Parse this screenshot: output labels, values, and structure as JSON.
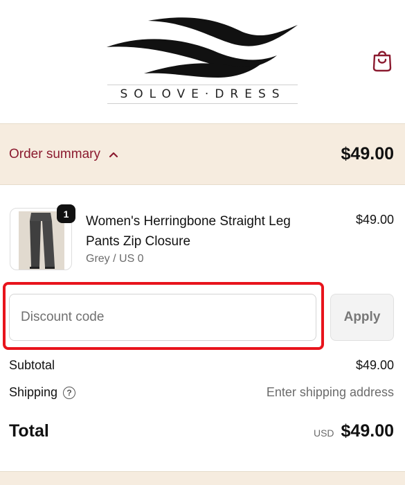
{
  "header": {
    "brand": "SOLOVE·DRESS",
    "cart_icon": "shopping-bag-icon"
  },
  "summary": {
    "toggle_label": "Order summary",
    "toggle_icon": "chevron-up-icon",
    "total": "$49.00",
    "accent_color": "#8b1a2f",
    "background_color": "#f6ecdf"
  },
  "line_item": {
    "quantity": "1",
    "title": "Women's Herringbone Straight Leg Pants Zip Closure",
    "variant": "Grey / US 0",
    "price": "$49.00"
  },
  "discount": {
    "placeholder": "Discount code",
    "value": "",
    "apply_label": "Apply",
    "highlight_color": "#e8141c"
  },
  "totals": {
    "subtotal_label": "Subtotal",
    "subtotal_value": "$49.00",
    "shipping_label": "Shipping",
    "shipping_help_icon": "question-circle-icon",
    "shipping_value": "Enter shipping address",
    "total_label": "Total",
    "currency": "USD",
    "total_value": "$49.00"
  }
}
